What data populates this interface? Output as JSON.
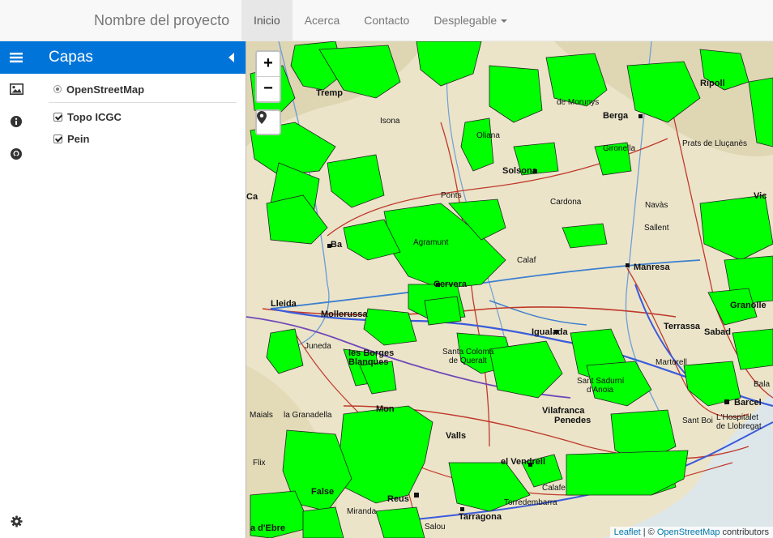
{
  "navbar": {
    "brand": "Nombre del proyecto",
    "items": [
      {
        "label": "Inicio",
        "active": true
      },
      {
        "label": "Acerca"
      },
      {
        "label": "Contacto"
      },
      {
        "label": "Desplegable",
        "dropdown": true
      }
    ]
  },
  "sidebar": {
    "title": "Capas",
    "tabs": [
      "menu-icon",
      "image-icon",
      "info-icon",
      "github-icon"
    ],
    "settings_icon": "gear-icon",
    "base_layers": [
      {
        "label": "OpenStreetMap",
        "selected": true
      }
    ],
    "overlays": [
      {
        "label": "Topo ICGC",
        "checked": true
      },
      {
        "label": "Pein",
        "checked": true
      }
    ]
  },
  "map": {
    "zoom_in": "+",
    "zoom_out": "−",
    "attribution": {
      "leaflet": "Leaflet",
      "sep": " | © ",
      "osm": "OpenStreetMap",
      "suffix": " contributors"
    },
    "places": {
      "tremp": "Tremp",
      "isona": "Isona",
      "oliana": "Oliana",
      "solsona": "Solsona",
      "cardona": "Cardona",
      "berga": "Berga",
      "ripoll": "Ripoll",
      "ponts": "Ponts",
      "agramunt": "Agramunt",
      "cervera": "Cervera",
      "lleida": "Lleida",
      "mollerussa": "Mollerussa",
      "borges": "les Borges",
      "blanques": "Blanques",
      "igualada": "Igualada",
      "manresa": "Manresa",
      "terrassa": "Terrassa",
      "sabadell": "Sabad",
      "granollers": "Granolle",
      "martorell": "Martorell",
      "barcelona": "Barcel",
      "valls": "Valls",
      "reus": "Reus",
      "tarragona": "Tarragona",
      "montblanc": "Mon",
      "vilafranca": "Vilafranca",
      "penedes": "Penedes",
      "vendrell": "el Vendrell",
      "calafell": "Calafe",
      "torredembarra": "Torredembarra",
      "hospitalet": "L'Hospitalet",
      "llobregat": "de Llobregat",
      "gironella": "Gironella",
      "pratsdl": "Prats de Lluçanès",
      "navas": "Navàs",
      "sallent": "Sallent",
      "granadella": "la Granadella",
      "juneda": "Juneda",
      "santacoloma": "Santa Coloma",
      "dequeralt": "de Queralt",
      "santsadurni": "Sant Sadurní",
      "danoia": "d'Anoia",
      "calaf": "Calaf",
      "falset": "False",
      "bala": "Bala",
      "balaguer": "Ba",
      "morunys": "de Morunys",
      "vic": "Vic",
      "cerdanyola": "Sant Boi",
      "miranda": "Miranda",
      "salou": "Salou",
      "flix": "Flix",
      "maials": "Maials",
      "dEbre": "a d'Ebre",
      "ca": "Ca"
    }
  }
}
